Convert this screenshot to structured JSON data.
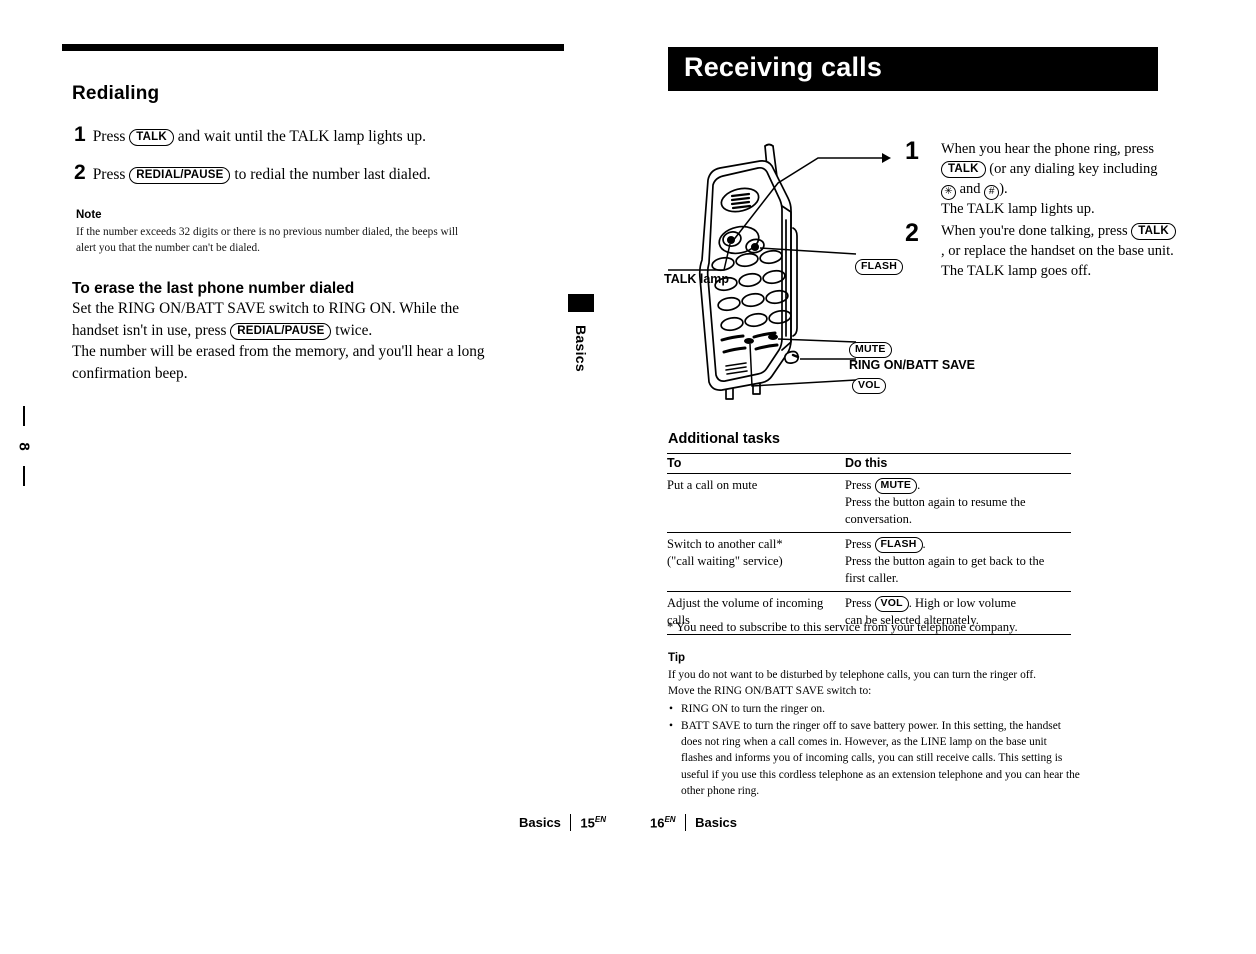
{
  "left_page": {
    "heading": "Redialing",
    "steps": [
      {
        "num": "1",
        "pre": "Press",
        "key": "TALK",
        "post": "and wait until the TALK lamp lights up."
      },
      {
        "num": "2",
        "pre": "Press",
        "key": "REDIAL/PAUSE",
        "post": "to redial the number last dialed."
      }
    ],
    "note": {
      "heading": "Note",
      "body": "If the number exceeds 32 digits or there is no previous number dialed, the beeps will alert you that the number can't be dialed."
    },
    "erase": {
      "heading": "To erase the last phone number dialed",
      "line1_pre": "Set the RING ON/BATT SAVE switch to RING ON. While the handset isn't in use, press",
      "line1_key": "REDIAL/PAUSE",
      "line1_post": "twice.",
      "line2": "The number will be erased from the memory, and you'll hear a long confirmation beep."
    },
    "page_marker": "8"
  },
  "thumb_tab": {
    "label": "Basics"
  },
  "right_page": {
    "banner_title": "Receiving calls",
    "illustration": {
      "callouts": {
        "talk_lamp": "TALK lamp",
        "flash": "FLASH",
        "mute": "MUTE",
        "ring_on_batt_save": "RING ON/BATT SAVE",
        "vol": "VOL"
      }
    },
    "steps": [
      {
        "num": "1",
        "seg1": "When you hear the phone ring, press",
        "key": "TALK",
        "seg2": "(or any dialing key including",
        "sym1": "✳",
        "seg3": "and",
        "sym2": "#",
        "seg4": ").",
        "seg5": "The TALK lamp lights up."
      },
      {
        "num": "2",
        "seg1": "When you're done talking, press",
        "key": "TALK",
        "seg2": ", or replace the handset on the base unit.",
        "seg5": "The TALK lamp goes off."
      }
    ],
    "additional_tasks": {
      "heading": "Additional tasks",
      "columns": [
        "To",
        "Do this"
      ],
      "rows": [
        {
          "to": "Put a call on mute",
          "do_pre": "Press",
          "do_key": "MUTE",
          "do_post": ".",
          "do_extra": "Press the button again to resume the conversation."
        },
        {
          "to_line1": "Switch to another call*",
          "to_line2": "(\"call waiting\" service)",
          "do_pre": "Press",
          "do_key": "FLASH",
          "do_post": ".",
          "do_extra": "Press the button again to get back to the first caller."
        },
        {
          "to": "Adjust the volume of incoming calls",
          "do_pre": "Press",
          "do_key": "VOL",
          "do_post": ". High or low volume",
          "do_extra": "can be selected alternately."
        }
      ]
    },
    "footnote": "* You need to subscribe to this service from your telephone company.",
    "tip": {
      "heading": "Tip",
      "line1": "If you do not want to be disturbed by telephone calls, you can turn the ringer off.",
      "line2": "Move the RING ON/BATT SAVE switch to:",
      "bullets": [
        "RING ON to turn the ringer on.",
        "BATT SAVE to turn the ringer off to save battery power.  In this setting, the handset does not ring when a call comes in.  However, as the LINE lamp on the base unit flashes and informs you of incoming calls, you can still receive calls. This setting is useful if you use this cordless telephone as an extension telephone and you can hear the other phone ring."
      ]
    }
  },
  "footer": {
    "left_label": "Basics",
    "left_page_num": "15",
    "left_page_sup": "EN",
    "right_page_num": "16",
    "right_page_sup": "EN",
    "right_label": "Basics"
  }
}
